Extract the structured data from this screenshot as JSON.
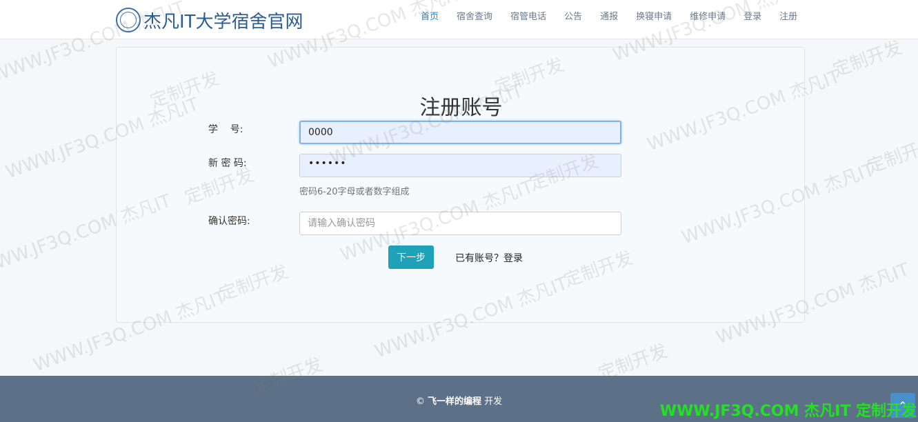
{
  "header": {
    "brand_title": "杰凡IT大学宿舍官网",
    "logo_icon": "university-seal-icon",
    "nav": [
      {
        "label": "首页",
        "active": true
      },
      {
        "label": "宿舍查询"
      },
      {
        "label": "宿管电话"
      },
      {
        "label": "公告"
      },
      {
        "label": "通报"
      },
      {
        "label": "换寝申请"
      },
      {
        "label": "维修申请"
      },
      {
        "label": "登录"
      },
      {
        "label": "注册"
      }
    ]
  },
  "form": {
    "title": "注册账号",
    "student_id_label": "学    号:",
    "student_id_value": "0000",
    "password_label": "新 密 码:",
    "password_masked": "••••••",
    "password_help": "密码6-20字母或者数字组成",
    "confirm_label": "确认密码:",
    "confirm_placeholder": "请输入确认密码",
    "next_button": "下一步",
    "login_link": "已有账号？登录"
  },
  "footer": {
    "copyright_symbol": "©",
    "author": "飞一样的编程",
    "suffix": "开发",
    "back_to_top_icon": "chevron-up-icon",
    "promo": "WWW.JF3Q.COM 杰凡IT  定制开发"
  },
  "watermark": {
    "text_site": "WWW.JF3Q.COM 杰凡IT",
    "text_custom": "定制开发"
  },
  "colors": {
    "accent": "#1fa2b8",
    "brand": "#2a5d92",
    "footer_bg": "#5c7187",
    "promo": "#22e022"
  }
}
